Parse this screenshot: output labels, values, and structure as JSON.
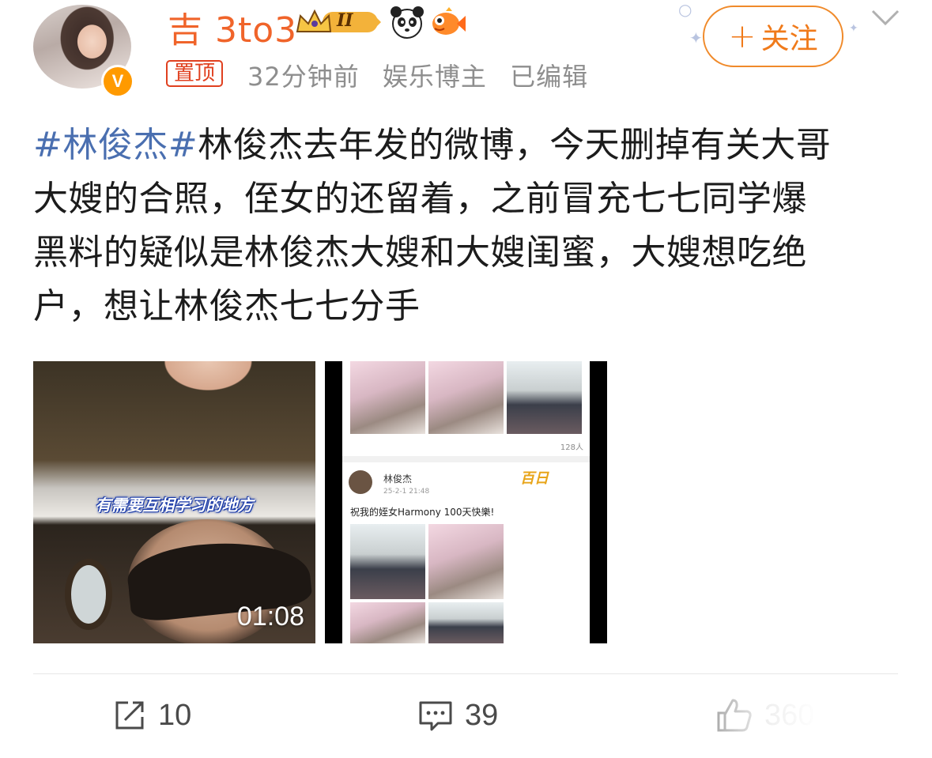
{
  "author": {
    "name": "吉 3to3",
    "verified_badge": "V",
    "pin_label": "置顶",
    "time": "32分钟前",
    "category": "娱乐博主",
    "edited": "已编辑",
    "level_badge": "II"
  },
  "follow": {
    "plus": "+",
    "label": "关注"
  },
  "post": {
    "hashtag": "#林俊杰#",
    "lines": [
      "林俊杰去年发的微博，今天删掉有关大哥",
      "大嫂的合照，侄女的还留着，之前冒充七七同学爆",
      "黑料的疑似是林俊杰大嫂和大嫂闺蜜，大嫂想吃绝",
      "户，想让林俊杰七七分手"
    ]
  },
  "media": {
    "video": {
      "subtitle": "有需要互相学习的地方",
      "duration": "01:08"
    },
    "screenshot": {
      "likes": "128人",
      "name": "林俊杰",
      "date": "25-2-1 21:48",
      "text": "祝我的姪女Harmony 100天快樂!",
      "sticker": "百日"
    }
  },
  "actions": {
    "share_count": "10",
    "comment_count": "39",
    "like_count": "360"
  },
  "icons": {
    "share": "share-icon",
    "comment": "comment-icon",
    "like": "thumbs-up-icon",
    "more": "chevron-down-icon",
    "panda": "panda-icon",
    "fish": "fish-icon",
    "crown": "crown-icon"
  },
  "colors": {
    "username": "#f0642a",
    "hashtag": "#4a6fb0",
    "follow": "#f07a1a",
    "pin": "#e0401f"
  }
}
